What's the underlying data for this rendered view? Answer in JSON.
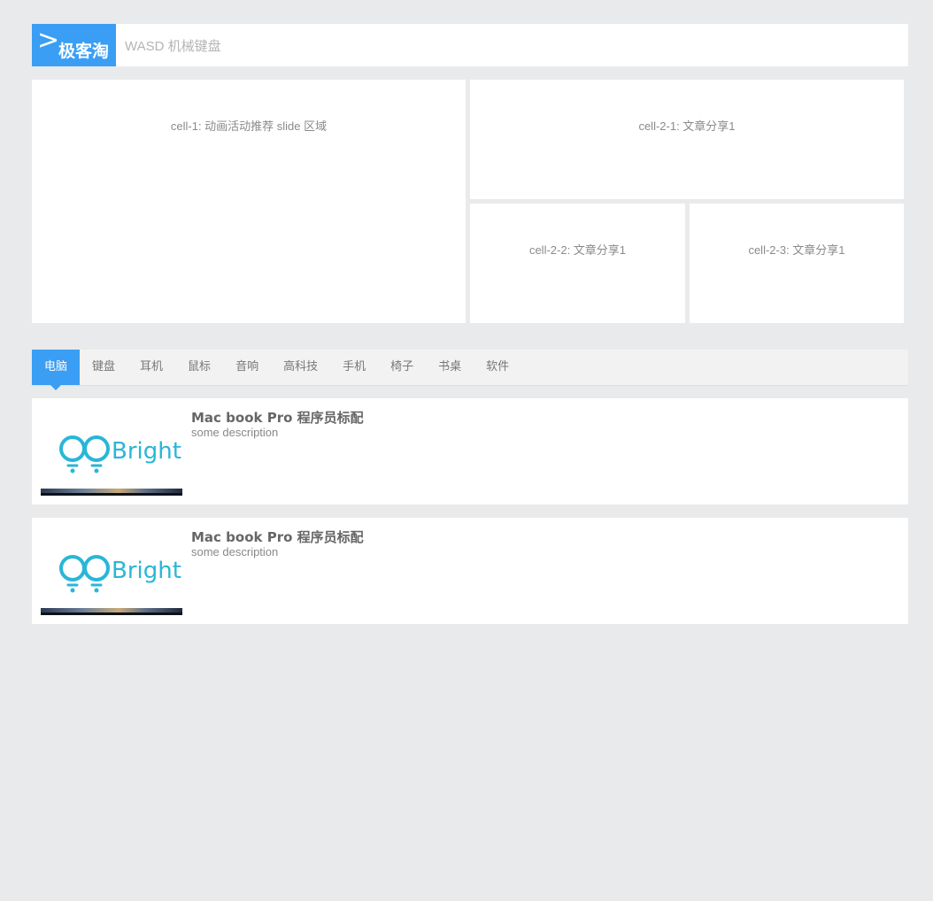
{
  "header": {
    "logo_text": "极客淘",
    "logo_chevron": ">",
    "search_value": "WASD 机械键盘"
  },
  "grid": {
    "cell_1": "cell-1: 动画活动推荐 slide 区域",
    "cell_2_1": "cell-2-1:  文章分享1",
    "cell_2_2": "cell-2-2:  文章分享1",
    "cell_2_3": "cell-2-3:  文章分享1"
  },
  "tabs": [
    {
      "label": "电脑",
      "active": true
    },
    {
      "label": "键盘"
    },
    {
      "label": "耳机"
    },
    {
      "label": "鼠标"
    },
    {
      "label": "音响"
    },
    {
      "label": "高科技"
    },
    {
      "label": "手机"
    },
    {
      "label": "椅子"
    },
    {
      "label": "书桌"
    },
    {
      "label": "软件"
    }
  ],
  "items": [
    {
      "title": "Mac book Pro 程序员标配",
      "description": "some description",
      "thumb_brand": "BrightB"
    },
    {
      "title": "Mac book Pro 程序员标配",
      "description": "some description",
      "thumb_brand": "BrightB"
    }
  ],
  "colors": {
    "accent": "#3a9ef4",
    "background": "#e9eaec",
    "brand_logo": "#29b6d8"
  },
  "icons": {
    "thumb_logo": "lightbulb-pair-icon"
  }
}
